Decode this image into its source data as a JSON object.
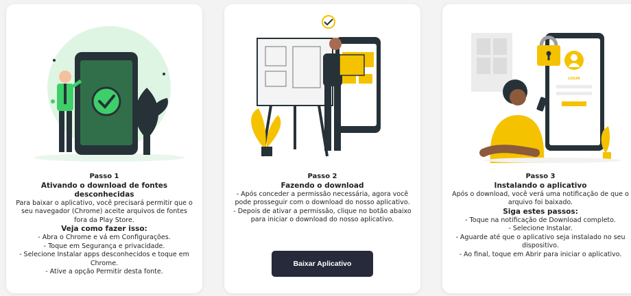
{
  "cards": [
    {
      "step": "Passo 1",
      "title": "Ativando o download de fontes desconhecidas",
      "intro": "Para baixar o aplicativo, você precisará permitir que o seu navegador (Chrome) aceite arquivos de fontes fora da Play Store.",
      "subtitle": "Veja como fazer isso:",
      "lines": [
        "- Abra o Chrome e vá em Configurações.",
        "- Toque em Segurança e privacidade.",
        "- Selecione Instalar apps desconhecidos e toque em Chrome.",
        "- Ative a opção Permitir desta fonte."
      ]
    },
    {
      "step": "Passo 2",
      "title": "Fazendo o download",
      "lines": [
        "- Após conceder a permissão necessária, agora você pode prosseguir com o download do nosso aplicativo.",
        "- Depois de ativar a permissão, clique no botão abaixo para iniciar o download do nosso aplicativo."
      ],
      "button_label": "Baixar Aplicativo"
    },
    {
      "step": "Passo 3",
      "title": "Instalando o aplicativo",
      "intro": "Após o download, você verá uma notificação de que o arquivo foi baixado.",
      "subtitle": "Siga estes passos:",
      "lines": [
        "- Toque na notificação de Download completo.",
        "- Selecione Instalar.",
        "- Aguarde até que o aplicativo seja instalado no seu dispositivo.",
        "- Ao final, toque em Abrir para iniciar o aplicativo."
      ]
    }
  ],
  "illustrations": {
    "card1": {
      "screen_text": "",
      "icon": "checkmark-icon"
    },
    "card2": {
      "icon": "easel-wireframe"
    },
    "card3": {
      "screen_title": "LOGIN",
      "icon": "padlock-icon"
    }
  },
  "colors": {
    "accent_green": "#3ecf6a",
    "accent_yellow": "#f5c200",
    "button_bg": "#262a3a",
    "dark": "#263238"
  }
}
